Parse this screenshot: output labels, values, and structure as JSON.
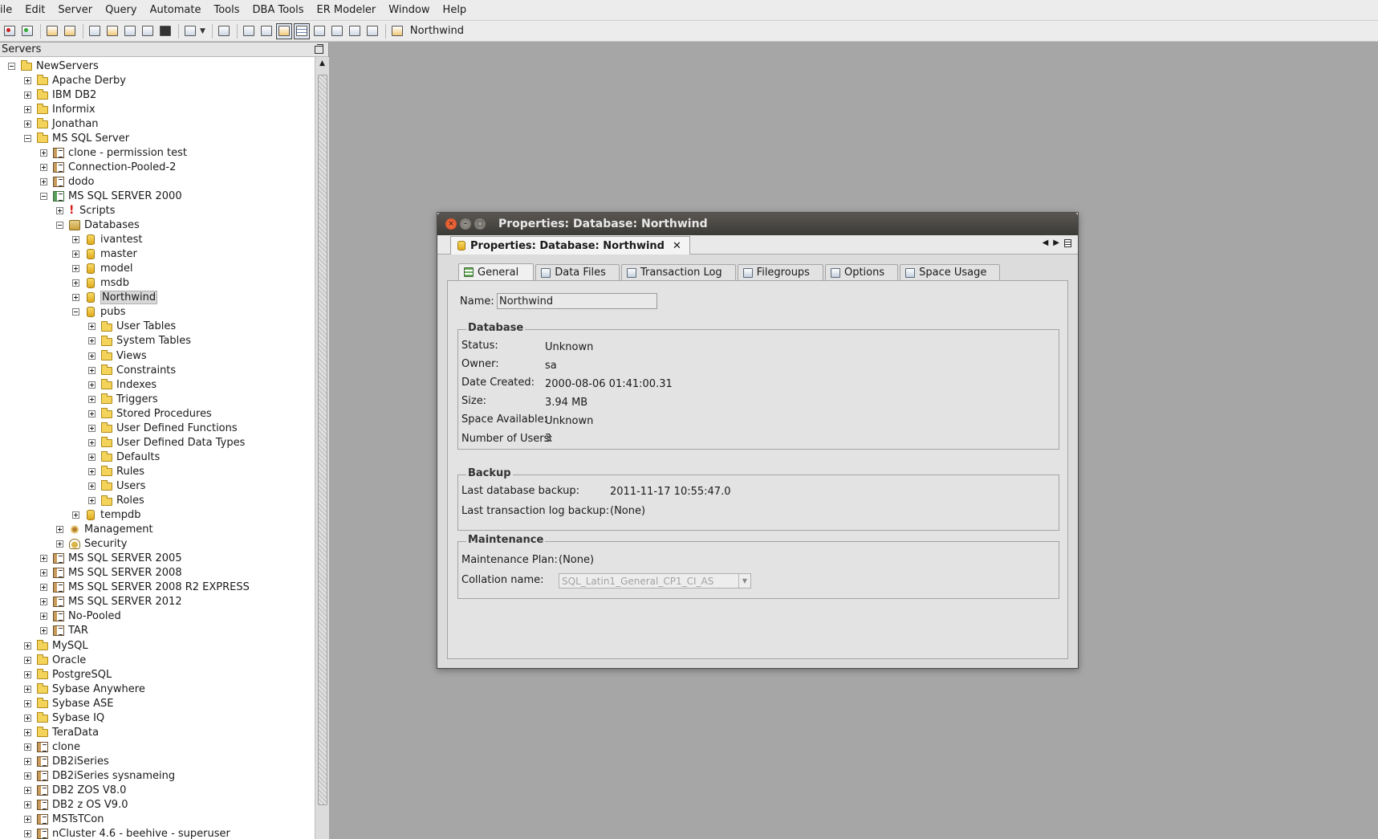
{
  "menu": [
    "ile",
    "Edit",
    "Server",
    "Query",
    "Automate",
    "Tools",
    "DBA Tools",
    "ER Modeler",
    "Window",
    "Help"
  ],
  "toolbar": {
    "database_name": "Northwind"
  },
  "servers_panel": {
    "title": "Servers"
  },
  "tree": [
    {
      "label": "NewServers",
      "depth": 0,
      "expander": "minus",
      "icon": "folder-icon"
    },
    {
      "label": "Apache Derby",
      "depth": 1,
      "expander": "plus",
      "icon": "folder-icon"
    },
    {
      "label": "IBM DB2",
      "depth": 1,
      "expander": "plus",
      "icon": "folder-icon"
    },
    {
      "label": "Informix",
      "depth": 1,
      "expander": "plus",
      "icon": "folder-icon"
    },
    {
      "label": "Jonathan",
      "depth": 1,
      "expander": "plus",
      "icon": "folder-icon"
    },
    {
      "label": "MS SQL Server",
      "depth": 1,
      "expander": "minus",
      "icon": "folder-icon"
    },
    {
      "label": "clone - permission test",
      "depth": 2,
      "expander": "plus",
      "icon": "server-icon"
    },
    {
      "label": "Connection-Pooled-2",
      "depth": 2,
      "expander": "plus",
      "icon": "server-icon"
    },
    {
      "label": "dodo",
      "depth": 2,
      "expander": "plus",
      "icon": "server-icon"
    },
    {
      "label": "MS SQL SERVER 2000",
      "depth": 2,
      "expander": "minus",
      "icon": "server-connected-icon"
    },
    {
      "label": "Scripts",
      "depth": 3,
      "expander": "plus",
      "icon": "scripts-icon"
    },
    {
      "label": "Databases",
      "depth": 3,
      "expander": "minus",
      "icon": "databases-icon"
    },
    {
      "label": "ivantest",
      "depth": 4,
      "expander": "plus",
      "icon": "database-icon"
    },
    {
      "label": "master",
      "depth": 4,
      "expander": "plus",
      "icon": "database-icon"
    },
    {
      "label": "model",
      "depth": 4,
      "expander": "plus",
      "icon": "database-icon"
    },
    {
      "label": "msdb",
      "depth": 4,
      "expander": "plus",
      "icon": "database-icon"
    },
    {
      "label": "Northwind",
      "depth": 4,
      "expander": "plus",
      "icon": "database-icon",
      "selected": true
    },
    {
      "label": "pubs",
      "depth": 4,
      "expander": "minus",
      "icon": "database-icon"
    },
    {
      "label": "User Tables",
      "depth": 5,
      "expander": "plus",
      "icon": "folder-icon"
    },
    {
      "label": "System Tables",
      "depth": 5,
      "expander": "plus",
      "icon": "folder-icon"
    },
    {
      "label": "Views",
      "depth": 5,
      "expander": "plus",
      "icon": "folder-icon"
    },
    {
      "label": "Constraints",
      "depth": 5,
      "expander": "plus",
      "icon": "folder-icon"
    },
    {
      "label": "Indexes",
      "depth": 5,
      "expander": "plus",
      "icon": "folder-icon"
    },
    {
      "label": "Triggers",
      "depth": 5,
      "expander": "plus",
      "icon": "folder-icon"
    },
    {
      "label": "Stored Procedures",
      "depth": 5,
      "expander": "plus",
      "icon": "folder-icon"
    },
    {
      "label": "User Defined Functions",
      "depth": 5,
      "expander": "plus",
      "icon": "folder-icon"
    },
    {
      "label": "User Defined Data Types",
      "depth": 5,
      "expander": "plus",
      "icon": "folder-icon"
    },
    {
      "label": "Defaults",
      "depth": 5,
      "expander": "plus",
      "icon": "folder-icon"
    },
    {
      "label": "Rules",
      "depth": 5,
      "expander": "plus",
      "icon": "folder-icon"
    },
    {
      "label": "Users",
      "depth": 5,
      "expander": "plus",
      "icon": "folder-icon"
    },
    {
      "label": "Roles",
      "depth": 5,
      "expander": "plus",
      "icon": "folder-icon"
    },
    {
      "label": "tempdb",
      "depth": 4,
      "expander": "plus",
      "icon": "database-icon"
    },
    {
      "label": "Management",
      "depth": 3,
      "expander": "plus",
      "icon": "management-icon"
    },
    {
      "label": "Security",
      "depth": 3,
      "expander": "plus",
      "icon": "security-icon"
    },
    {
      "label": "MS SQL SERVER 2005",
      "depth": 2,
      "expander": "plus",
      "icon": "server-icon"
    },
    {
      "label": "MS SQL SERVER 2008",
      "depth": 2,
      "expander": "plus",
      "icon": "server-icon"
    },
    {
      "label": "MS SQL SERVER 2008 R2 EXPRESS",
      "depth": 2,
      "expander": "plus",
      "icon": "server-icon"
    },
    {
      "label": "MS SQL SERVER 2012",
      "depth": 2,
      "expander": "plus",
      "icon": "server-icon"
    },
    {
      "label": "No-Pooled",
      "depth": 2,
      "expander": "plus",
      "icon": "server-icon"
    },
    {
      "label": "TAR",
      "depth": 2,
      "expander": "plus",
      "icon": "server-icon"
    },
    {
      "label": "MySQL",
      "depth": 1,
      "expander": "plus",
      "icon": "folder-icon"
    },
    {
      "label": "Oracle",
      "depth": 1,
      "expander": "plus",
      "icon": "folder-icon"
    },
    {
      "label": "PostgreSQL",
      "depth": 1,
      "expander": "plus",
      "icon": "folder-icon"
    },
    {
      "label": "Sybase Anywhere",
      "depth": 1,
      "expander": "plus",
      "icon": "folder-icon"
    },
    {
      "label": "Sybase ASE",
      "depth": 1,
      "expander": "plus",
      "icon": "folder-icon"
    },
    {
      "label": "Sybase IQ",
      "depth": 1,
      "expander": "plus",
      "icon": "folder-icon"
    },
    {
      "label": "TeraData",
      "depth": 1,
      "expander": "plus",
      "icon": "folder-icon"
    },
    {
      "label": "clone",
      "depth": 1,
      "expander": "plus",
      "icon": "server-icon"
    },
    {
      "label": "DB2iSeries",
      "depth": 1,
      "expander": "plus",
      "icon": "server-icon"
    },
    {
      "label": "DB2iSeries sysnameing",
      "depth": 1,
      "expander": "plus",
      "icon": "server-icon"
    },
    {
      "label": "DB2 ZOS V8.0",
      "depth": 1,
      "expander": "plus",
      "icon": "server-icon"
    },
    {
      "label": "DB2 z OS V9.0",
      "depth": 1,
      "expander": "plus",
      "icon": "server-icon"
    },
    {
      "label": "MSTsTCon",
      "depth": 1,
      "expander": "plus",
      "icon": "server-icon"
    },
    {
      "label": "nCluster 4.6 - beehive - superuser",
      "depth": 1,
      "expander": "plus",
      "icon": "server-icon"
    }
  ],
  "window": {
    "title": "Properties: Database: Northwind",
    "doc_tab": "Properties: Database: Northwind",
    "doc_tab_close": "✕"
  },
  "tabs": [
    "General",
    "Data Files",
    "Transaction Log",
    "Filegroups",
    "Options",
    "Space Usage"
  ],
  "general": {
    "name_label": "Name:",
    "name_value": "Northwind",
    "database": {
      "title": "Database",
      "fields": [
        {
          "label": "Status:",
          "value": "Unknown"
        },
        {
          "label": "Owner:",
          "value": "sa"
        },
        {
          "label": "Date Created:",
          "value": "2000-08-06 01:41:00.31"
        },
        {
          "label": "Size:",
          "value": "3.94 MB"
        },
        {
          "label": "Space Available:",
          "value": "Unknown"
        },
        {
          "label": "Number of Users:",
          "value": "3"
        }
      ]
    },
    "backup": {
      "title": "Backup",
      "fields": [
        {
          "label": "Last database backup:",
          "value": "2011-11-17 10:55:47.0"
        },
        {
          "label": "Last transaction log backup:",
          "value": "(None)"
        }
      ]
    },
    "maintenance": {
      "title": "Maintenance",
      "plan_label": "Maintenance Plan:",
      "plan_value": "(None)",
      "collation_label": "Collation name:",
      "collation_value": "SQL_Latin1_General_CP1_CI_AS"
    }
  }
}
